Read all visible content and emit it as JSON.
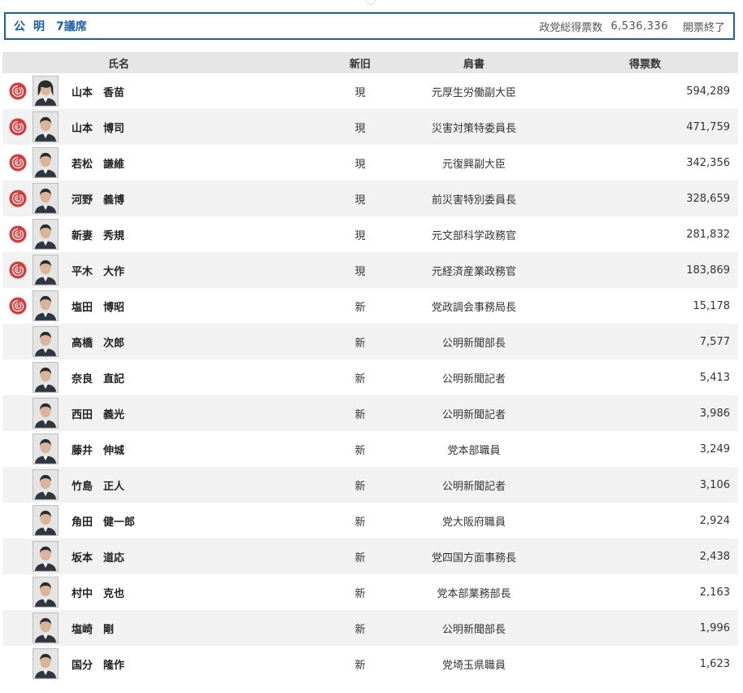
{
  "party": {
    "name": "公明",
    "seats": "7議席",
    "total_votes_label": "政党総得票数",
    "total_votes": "6,536,336",
    "status": "開票終了"
  },
  "columns": {
    "name": "氏名",
    "new_old": "新旧",
    "title": "肩書",
    "votes": "得票数"
  },
  "colors": {
    "accent": "#1a5fa8",
    "rose": "#d93a3a",
    "header_bg": "#e6e6e6",
    "stripe": "#f2f2f2"
  },
  "candidates": [
    {
      "elected": true,
      "surname": "山本",
      "given": "香苗",
      "status": "現",
      "title": "元厚生労働副大臣",
      "votes": "594,289",
      "gender": "female"
    },
    {
      "elected": true,
      "surname": "山本",
      "given": "博司",
      "status": "現",
      "title": "災害対策特委員長",
      "votes": "471,759",
      "gender": "male"
    },
    {
      "elected": true,
      "surname": "若松",
      "given": "謙維",
      "status": "現",
      "title": "元復興副大臣",
      "votes": "342,356",
      "gender": "male"
    },
    {
      "elected": true,
      "surname": "河野",
      "given": "義博",
      "status": "現",
      "title": "前災害特別委員長",
      "votes": "328,659",
      "gender": "male"
    },
    {
      "elected": true,
      "surname": "新妻",
      "given": "秀規",
      "status": "現",
      "title": "元文部科学政務官",
      "votes": "281,832",
      "gender": "male"
    },
    {
      "elected": true,
      "surname": "平木",
      "given": "大作",
      "status": "現",
      "title": "元経済産業政務官",
      "votes": "183,869",
      "gender": "male"
    },
    {
      "elected": true,
      "surname": "塩田",
      "given": "博昭",
      "status": "新",
      "title": "党政調会事務局長",
      "votes": "15,178",
      "gender": "male"
    },
    {
      "elected": false,
      "surname": "高橋",
      "given": "次郎",
      "status": "新",
      "title": "公明新聞部長",
      "votes": "7,577",
      "gender": "male"
    },
    {
      "elected": false,
      "surname": "奈良",
      "given": "直記",
      "status": "新",
      "title": "公明新聞記者",
      "votes": "5,413",
      "gender": "male"
    },
    {
      "elected": false,
      "surname": "西田",
      "given": "義光",
      "status": "新",
      "title": "公明新聞記者",
      "votes": "3,986",
      "gender": "male"
    },
    {
      "elected": false,
      "surname": "藤井",
      "given": "伸城",
      "status": "新",
      "title": "党本部職員",
      "votes": "3,249",
      "gender": "male"
    },
    {
      "elected": false,
      "surname": "竹島",
      "given": "正人",
      "status": "新",
      "title": "公明新聞記者",
      "votes": "3,106",
      "gender": "male"
    },
    {
      "elected": false,
      "surname": "角田",
      "given": "健一郎",
      "status": "新",
      "title": "党大阪府職員",
      "votes": "2,924",
      "gender": "male"
    },
    {
      "elected": false,
      "surname": "坂本",
      "given": "道応",
      "status": "新",
      "title": "党四国方面事務長",
      "votes": "2,438",
      "gender": "male"
    },
    {
      "elected": false,
      "surname": "村中",
      "given": "克也",
      "status": "新",
      "title": "党本部業務部長",
      "votes": "2,163",
      "gender": "male"
    },
    {
      "elected": false,
      "surname": "塩崎",
      "given": "剛",
      "status": "新",
      "title": "公明新聞部長",
      "votes": "1,996",
      "gender": "male"
    },
    {
      "elected": false,
      "surname": "国分",
      "given": "隆作",
      "status": "新",
      "title": "党埼玉県職員",
      "votes": "1,623",
      "gender": "male"
    }
  ]
}
